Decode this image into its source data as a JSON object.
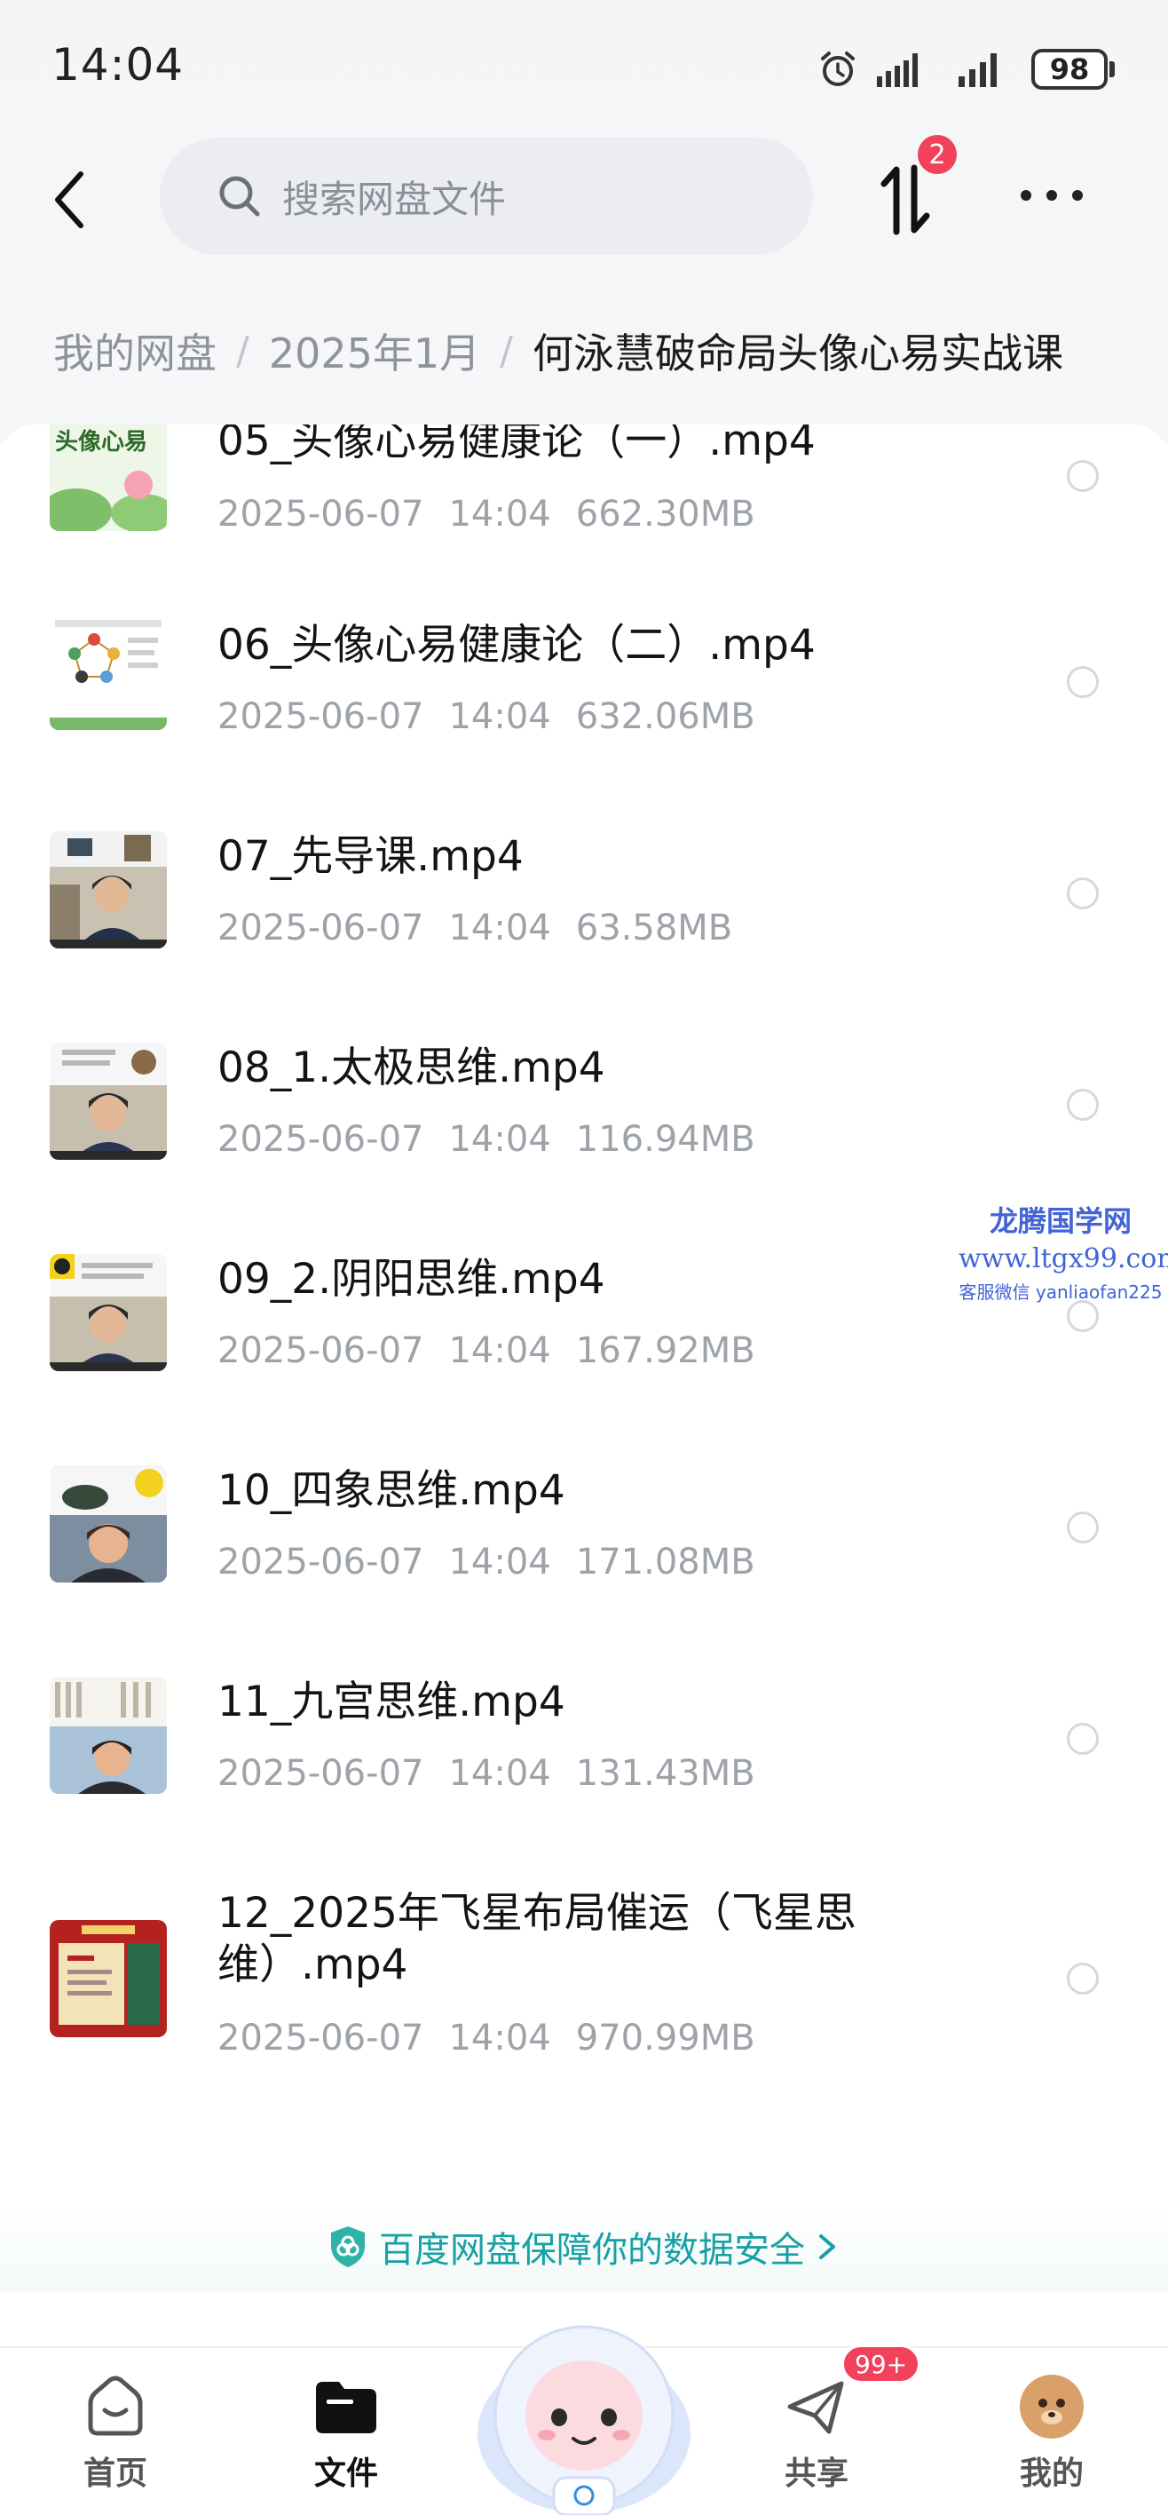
{
  "status_bar": {
    "time": "14:04",
    "battery": "98"
  },
  "header": {
    "search_placeholder": "搜索网盘文件",
    "transfer_badge": "2"
  },
  "breadcrumb": {
    "items": [
      "我的网盘",
      "2025年1月"
    ],
    "current": "何泳慧破命局头像心易实战课"
  },
  "files": [
    {
      "name": "05_头像心易健康论（一）.mp4",
      "date": "2025-06-07",
      "time": "14:04",
      "size": "662.30MB"
    },
    {
      "name": "06_头像心易健康论（二）.mp4",
      "date": "2025-06-07",
      "time": "14:04",
      "size": "632.06MB"
    },
    {
      "name": "07_先导课.mp4",
      "date": "2025-06-07",
      "time": "14:04",
      "size": "63.58MB"
    },
    {
      "name": "08_1.太极思维.mp4",
      "date": "2025-06-07",
      "time": "14:04",
      "size": "116.94MB"
    },
    {
      "name": "09_2.阴阳思维.mp4",
      "date": "2025-06-07",
      "time": "14:04",
      "size": "167.92MB"
    },
    {
      "name": "10_四象思维.mp4",
      "date": "2025-06-07",
      "time": "14:04",
      "size": "171.08MB"
    },
    {
      "name": "11_九宫思维.mp4",
      "date": "2025-06-07",
      "time": "14:04",
      "size": "131.43MB"
    },
    {
      "name": "12_2025年飞星布局催运（飞星思维）.mp4",
      "date": "2025-06-07",
      "time": "14:04",
      "size": "970.99MB"
    }
  ],
  "thumb_text": {
    "first": "头像心易"
  },
  "watermark": {
    "line1": "龙腾国学网",
    "line2": "www.ltgx99.com",
    "line3": "客服微信 yanliaofan225"
  },
  "security_banner": {
    "text": "百度网盘保障你的数据安全"
  },
  "bottom_nav": {
    "home": "首页",
    "files": "文件",
    "share": "共享",
    "share_badge": "99+",
    "mine": "我的"
  },
  "colors": {
    "accent_teal": "#17a1a6",
    "badge_red": "#f2415a",
    "watermark_blue": "#4164d6"
  },
  "icons": [
    "alarm-icon",
    "signal-icon",
    "back-arrow-icon",
    "search-icon",
    "transfer-icon",
    "more-icon",
    "shield-icon",
    "chevron-right-icon",
    "home-icon",
    "folder-icon",
    "share-icon",
    "avatar-icon"
  ]
}
